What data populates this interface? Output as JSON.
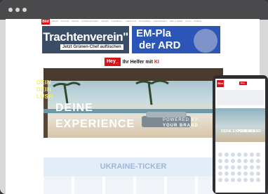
{
  "article": {
    "logo": "Bild",
    "nav_items": [
      "NEWS",
      "POLITIK",
      "REGIO",
      "UNTERHALTUNG",
      "SPORT",
      "FUSSBALL",
      "LIFESTYLE",
      "RATGEBER",
      "GESUNDHEIT",
      "SEX & LIEBE",
      "AUTO",
      "SPIELE"
    ],
    "teaser_left": {
      "headline": "Trachtenverein\"",
      "sub": "Jetzt Grünen-Chef auftischen"
    },
    "teaser_right": {
      "headline_line1": "EM-Pla",
      "headline_line2": "der ARD"
    }
  },
  "hey_bar": {
    "badge": "Hey_",
    "text": "Ihr Helfer mit ",
    "ki": "KI"
  },
  "banner": {
    "headline_line1": "DEINE",
    "headline_line2": "EXPERIENCE",
    "powered_line1": "POWERED BY",
    "powered_line2": "YOUR BRAND"
  },
  "ticker": {
    "label": "UKRAINE-TICKER"
  },
  "mobile": {
    "logo": "Bild",
    "badge": "Hey_",
    "banner_left": "DEINE EXPERIENCE",
    "banner_right": "YOUR BRAND",
    "claim_line1": "DEIN",
    "claim_line2": "DEIN",
    "claim_line3": "LUSH"
  },
  "colors": {
    "brand_red": "#d3141b",
    "claim_yellow": "#f5f06a"
  }
}
